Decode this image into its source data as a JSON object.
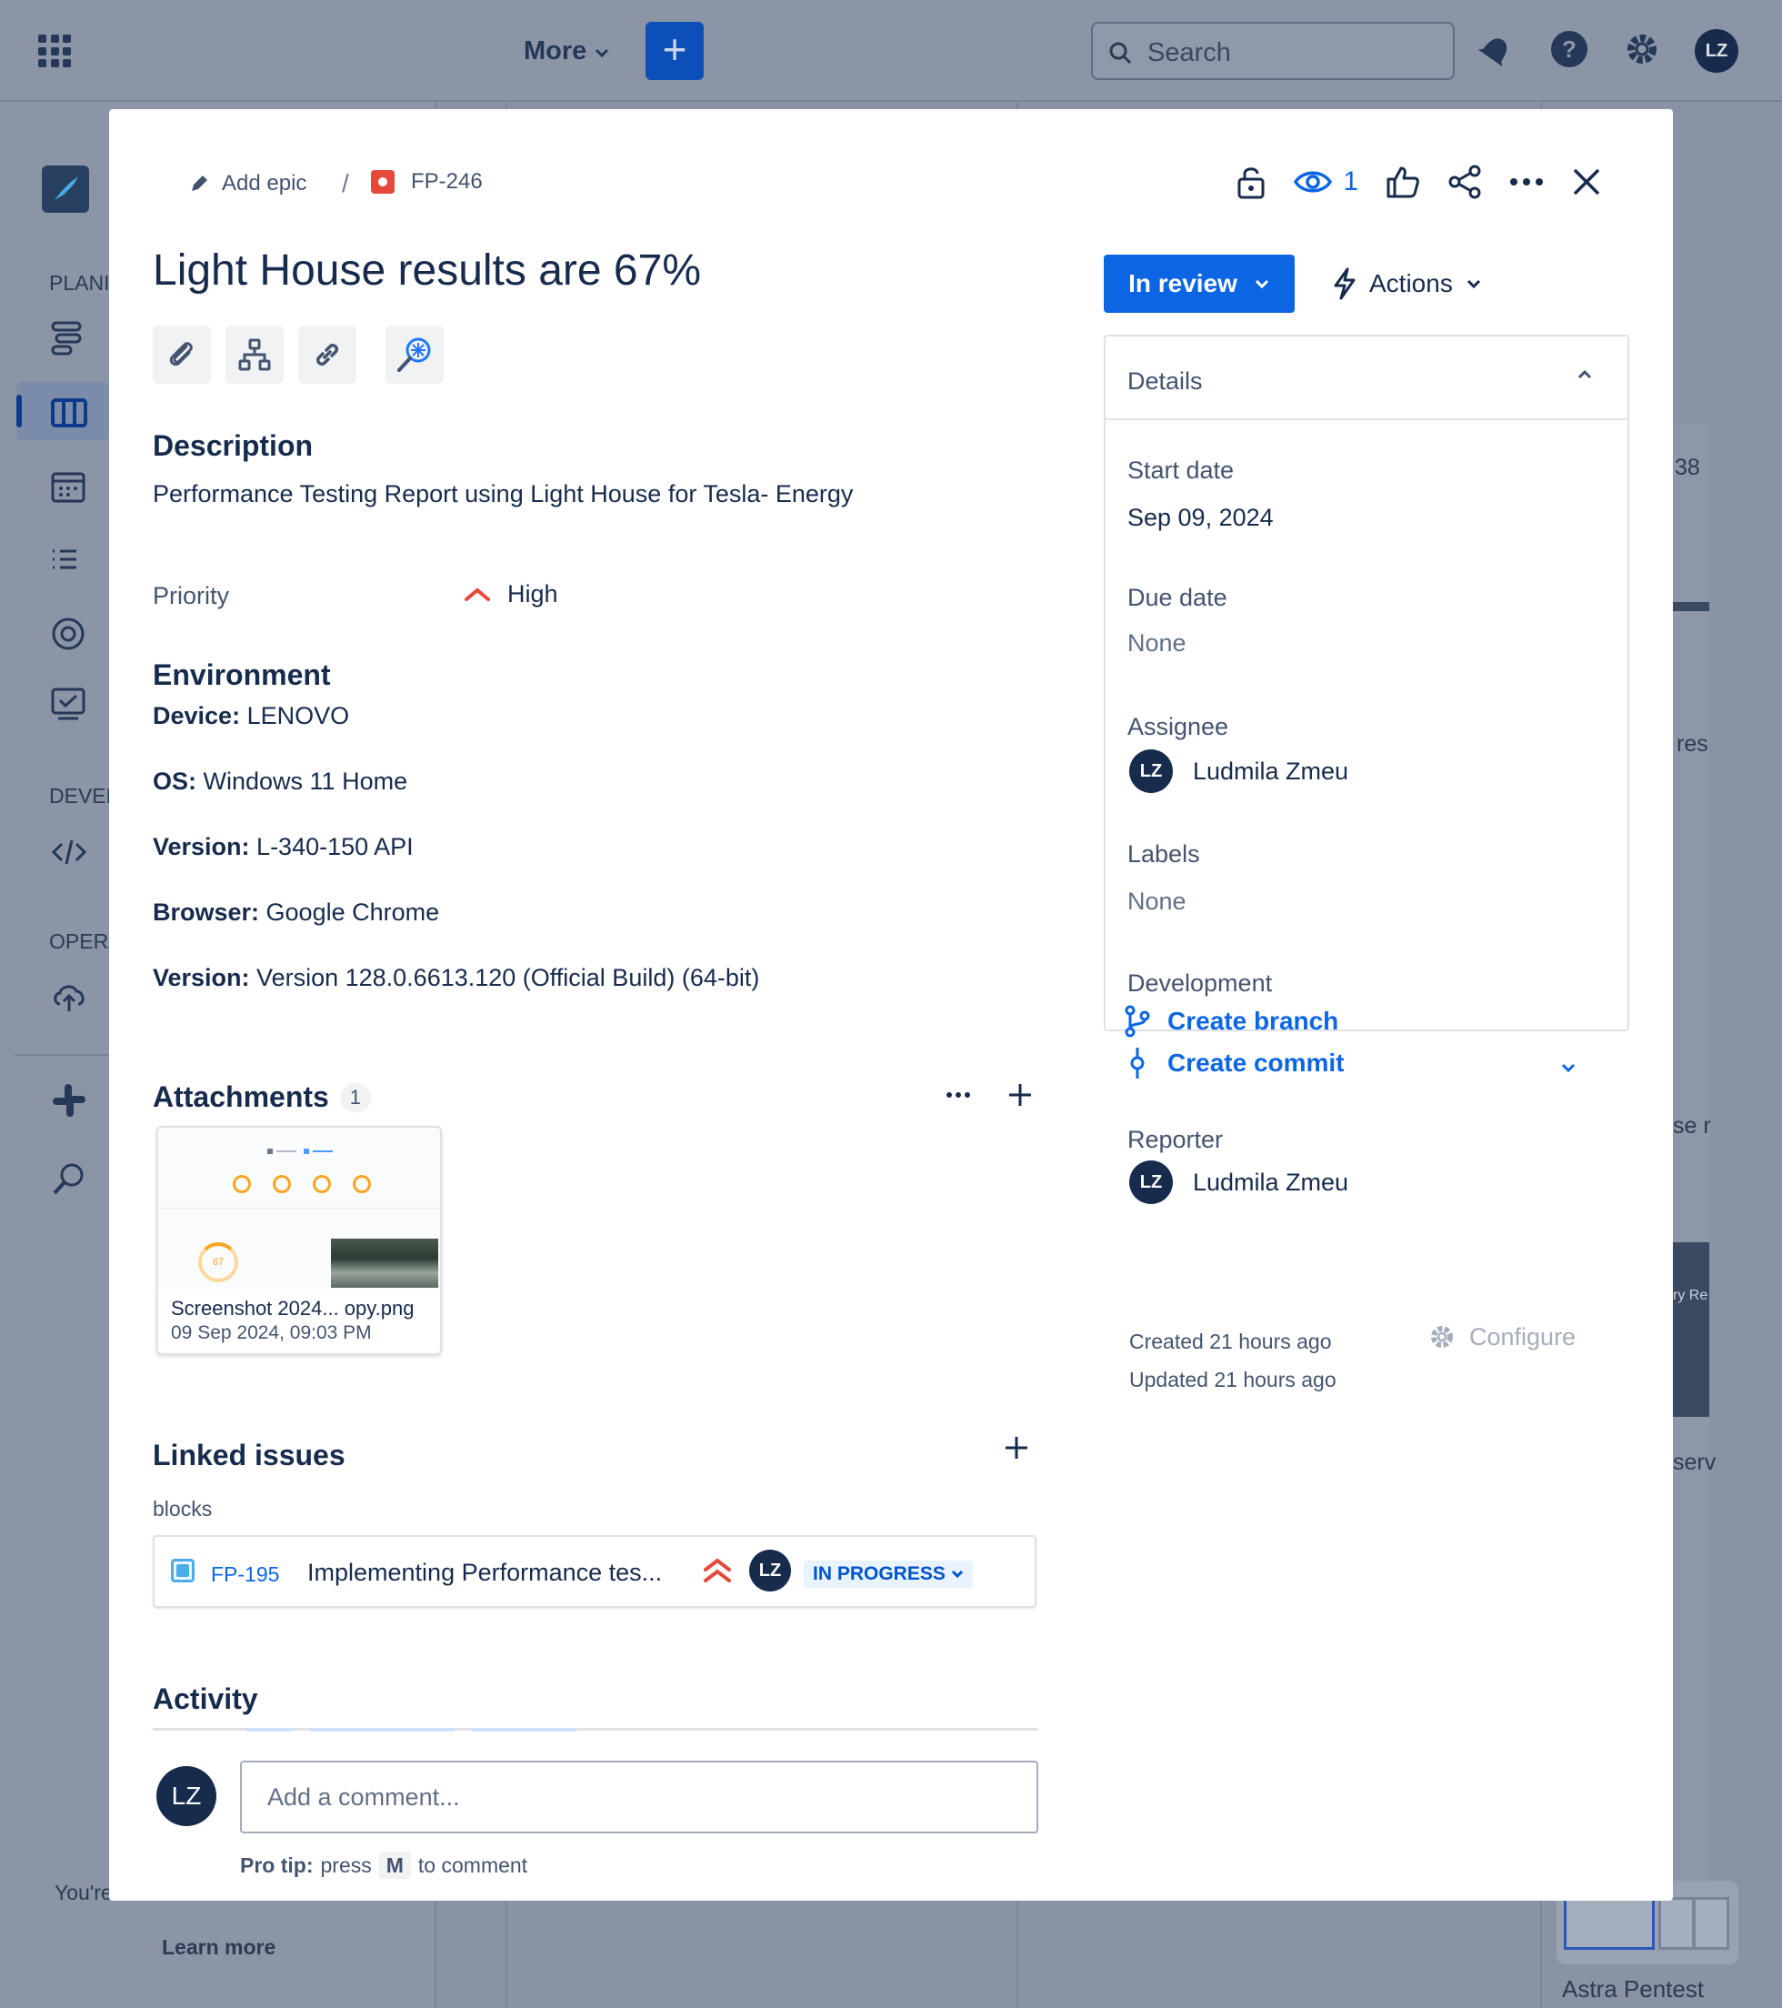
{
  "topbar": {
    "more_label": "More",
    "plus_label": "+",
    "search_placeholder": "Search",
    "avatar_initials": "LZ"
  },
  "sidebar": {
    "sections": [
      "PLANNING",
      "DEVELOPMENT",
      "OPERATIONS"
    ],
    "sections_visible": [
      "PLANI",
      "DEVEL",
      "OPER/"
    ],
    "footer_text": "You're",
    "learn_more": "Learn more"
  },
  "background": {
    "right_fragments": [
      "38",
      "res",
      "se r",
      "ry Re",
      "serv"
    ],
    "board_label": "Astra Pentest"
  },
  "issue": {
    "breadcrumb_epic": "Add epic",
    "breadcrumb_sep": "/",
    "key": "FP-246",
    "watchers": "1",
    "title": "Light House results are 67%",
    "description_heading": "Description",
    "description": "Performance Testing Report using Light House for Tesla- Energy",
    "priority_label": "Priority",
    "priority_value": "High",
    "environment_heading": "Environment",
    "environment": [
      {
        "label": "Device:",
        "value": " LENOVO"
      },
      {
        "label": "OS:",
        "value": " Windows 11 Home"
      },
      {
        "label": "Version:",
        "value": " L-340-150 API"
      },
      {
        "label": "Browser:",
        "value": " Google Chrome"
      },
      {
        "label": "Version:",
        "value": " Version 128.0.6613.120 (Official Build) (64-bit)"
      }
    ]
  },
  "attachments": {
    "heading": "Attachments",
    "count": "1",
    "items": [
      {
        "name": "Screenshot 2024... opy.png",
        "date": "09 Sep 2024, 09:03 PM",
        "score": "67"
      }
    ]
  },
  "linked_issues": {
    "heading": "Linked issues",
    "relation": "blocks",
    "items": [
      {
        "key": "FP-195",
        "summary": "Implementing Performance tes...",
        "assignee": "LZ",
        "status": "IN PROGRESS"
      }
    ]
  },
  "activity": {
    "heading": "Activity",
    "avatar": "LZ",
    "comment_placeholder": "Add a comment...",
    "protip_bold": "Pro tip:",
    "protip_press": "press",
    "protip_key": "M",
    "protip_end": "to comment"
  },
  "status": {
    "label": "In review",
    "actions_label": "Actions"
  },
  "details": {
    "heading": "Details",
    "start_date_label": "Start date",
    "start_date": "Sep 09, 2024",
    "due_date_label": "Due date",
    "due_date": "None",
    "assignee_label": "Assignee",
    "assignee_initials": "LZ",
    "assignee_name": "Ludmila Zmeu",
    "labels_label": "Labels",
    "labels_value": "None",
    "development_label": "Development",
    "create_branch": "Create branch",
    "create_commit": "Create commit",
    "reporter_label": "Reporter",
    "reporter_initials": "LZ",
    "reporter_name": "Ludmila Zmeu"
  },
  "meta": {
    "created": "Created 21 hours ago",
    "updated": "Updated 21 hours ago",
    "configure": "Configure"
  },
  "colors": {
    "brand_blue": "#0c66e4",
    "priority_high": "#e5493a",
    "status_bg": "#e9f2ff"
  }
}
